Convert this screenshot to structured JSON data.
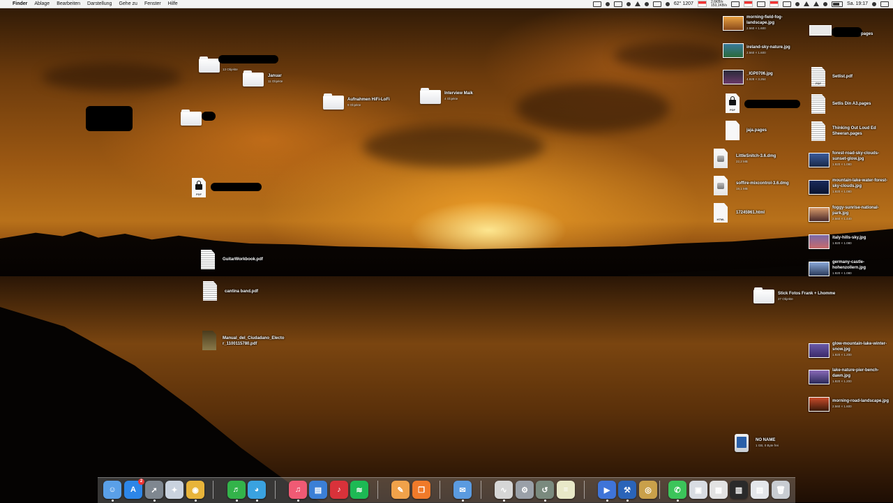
{
  "menubar": {
    "app_name": "Finder",
    "items": [
      "Ablage",
      "Bearbeiten",
      "Darstellung",
      "Gehe zu",
      "Fenster",
      "Hilfe"
    ],
    "weather": "62° 1207",
    "net_up": "2,6KB/s",
    "net_down": "153,1KB/s",
    "clock": "Sa. 19:17"
  },
  "desktop": {
    "folder_top": {
      "sub": "13 Objekte"
    },
    "folder_januar": {
      "label": "Januar",
      "sub": "11 Objekte"
    },
    "folder_aufnahmen": {
      "label": "Aufnahmen HiFi-LoFi",
      "sub": "9 Objekte"
    },
    "folder_interview": {
      "label": "Interview Maik",
      "sub": "4 Objekte"
    },
    "folder_stick": {
      "label": "Stick Fotos Frank + Lhomme",
      "sub": "27 Objekte"
    },
    "guitar": {
      "label": "GuitarWorkbook.pdf"
    },
    "cantina": {
      "label": "cantina band.pdf"
    },
    "manual": {
      "label1": "Manual_del_Ciudadano_Electo",
      "label2": "r_1100115780.pdf"
    },
    "pdf_badge": "PDF",
    "html_badge": "HTML",
    "right_col1": [
      {
        "label1": "morning-field-fog-",
        "label2": "landscape.jpg",
        "sub": "2.560 × 1.600"
      },
      {
        "label1": "ireland-sky-nature.jpg",
        "label2": "",
        "sub": "2.560 × 1.600"
      },
      {
        "label1": "_IGP0706.jpg",
        "label2": "",
        "sub": "4.928 × 3.264"
      },
      {
        "label1": "",
        "label2": "",
        "sub": ""
      },
      {
        "label1": "jaja.pages",
        "label2": "",
        "sub": ""
      },
      {
        "label1": "LittleSnitch-3.6.dmg",
        "label2": "",
        "sub": "22,2 MB"
      },
      {
        "label1": "soffire-mixcontrol-3.6.dmg",
        "label2": "",
        "sub": "19,1 MB"
      },
      {
        "label1": "17245961.html",
        "label2": "",
        "sub": ""
      }
    ],
    "right_col2": [
      {
        "label1": "pages",
        "label2": "",
        "sub": ""
      },
      {
        "label1": "Setlist.pdf",
        "label2": "",
        "sub": ""
      },
      {
        "label1": "Setlis Din A3.pages",
        "label2": "",
        "sub": ""
      },
      {
        "label1": "Thinking Out Loud Ed",
        "label2": "Sheeran.pages",
        "sub": ""
      },
      {
        "label1": "forest-road-sky-clouds-",
        "label2": "sunset-glow.jpg",
        "sub": "1.920 × 1.080"
      },
      {
        "label1": "mountain-lake-water-forest-",
        "label2": "sky-clouds.jpg",
        "sub": "1.920 × 1.080"
      },
      {
        "label1": "foggy-sunrise-national-",
        "label2": "park.jpg",
        "sub": "2.560 × 1.440"
      },
      {
        "label1": "italy-hills-sky.jpg",
        "label2": "",
        "sub": "1.920 × 1.080"
      },
      {
        "label1": "germany-castle-",
        "label2": "hohenzollern.jpg",
        "sub": "1.920 × 1.080"
      },
      {
        "label1": "glow-mountain-lake-winter-",
        "label2": "snow.jpg",
        "sub": "1.920 × 1.200"
      },
      {
        "label1": "lake-nature-pier-bench-",
        "label2": "dawn.jpg",
        "sub": "1.920 × 1.200"
      },
      {
        "label1": "morning-road-landscape.jpg",
        "label2": "",
        "sub": "2.560 × 1.600"
      }
    ],
    "drive": {
      "label": "NO NAME",
      "sub": "1 GB, 0 Byte frei"
    }
  },
  "dock": {
    "apps": [
      {
        "name": "finder-app",
        "glyph": "☺",
        "color": "#5aa0e8"
      },
      {
        "name": "app-store-app",
        "glyph": "A",
        "color": "#2d86e8",
        "badge": "2"
      },
      {
        "name": "launchpad-app",
        "glyph": "➚",
        "color": "#7f8790"
      },
      {
        "name": "safari-app",
        "glyph": "✦",
        "color": "#c9d2de"
      },
      {
        "name": "chrome-app",
        "glyph": "◉",
        "color": "#e8b43a"
      },
      {
        "name": "spotify-like-app",
        "glyph": "♬",
        "color": "#33b34a"
      },
      {
        "name": "tweetbot-app",
        "glyph": "◕",
        "color": "#3aa2e0"
      },
      {
        "name": "itunes-app",
        "glyph": "♫",
        "color": "#f05a74"
      },
      {
        "name": "keynote-app",
        "glyph": "▤",
        "color": "#3b7fd6"
      },
      {
        "name": "guitar-app",
        "glyph": "♪",
        "color": "#d9323a"
      },
      {
        "name": "spotify-app",
        "glyph": "≋",
        "color": "#1db954"
      },
      {
        "name": "pages-app",
        "glyph": "✎",
        "color": "#f0a24a"
      },
      {
        "name": "ibooks-app",
        "glyph": "❐",
        "color": "#f07a2a"
      },
      {
        "name": "mail-app",
        "glyph": "✉",
        "color": "#5b9be0"
      },
      {
        "name": "activity-monitor-app",
        "glyph": "∿",
        "color": "#d6d6d6"
      },
      {
        "name": "system-preferences-app",
        "glyph": "⚙",
        "color": "#9aa0a8"
      },
      {
        "name": "time-machine-app",
        "glyph": "↺",
        "color": "#7a8a7e"
      },
      {
        "name": "disk-utility-app",
        "glyph": "≡",
        "color": "#e8e8c8"
      },
      {
        "name": "quicktime-app",
        "glyph": "▶",
        "color": "#3f74d8"
      },
      {
        "name": "xcode-app",
        "glyph": "⚒",
        "color": "#2a64b8"
      },
      {
        "name": "instruments-app",
        "glyph": "◎",
        "color": "#c9a04a"
      },
      {
        "name": "messages-app",
        "glyph": "✆",
        "color": "#3cc45a"
      },
      {
        "name": "stack-1-app",
        "glyph": "▣",
        "color": "#d8dce2"
      },
      {
        "name": "stack-2-app",
        "glyph": "▦",
        "color": "#e2e2e2"
      },
      {
        "name": "stack-3-app",
        "glyph": "▥",
        "color": "#2a2a2a"
      },
      {
        "name": "stack-4-app",
        "glyph": "▤",
        "color": "#e4e6ea"
      },
      {
        "name": "trash-app",
        "glyph": "🗑",
        "color": "#c8ccd2"
      }
    ]
  }
}
